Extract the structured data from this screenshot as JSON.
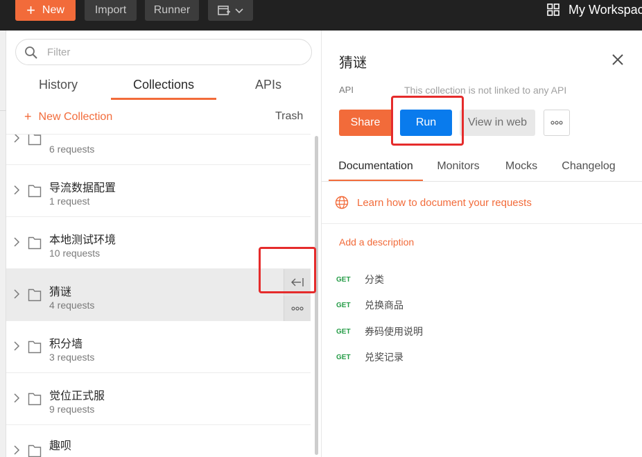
{
  "topbar": {
    "new_label": "New",
    "import_label": "Import",
    "runner_label": "Runner",
    "workspace_label": "My Workspac"
  },
  "sidebar": {
    "filter_placeholder": "Filter",
    "tabs": [
      {
        "label": "History"
      },
      {
        "label": "Collections"
      },
      {
        "label": "APIs"
      }
    ],
    "new_collection_label": "New Collection",
    "trash_label": "Trash",
    "collections": [
      {
        "name": "",
        "count": "6 requests"
      },
      {
        "name": "导流数据配置",
        "count": "1 request"
      },
      {
        "name": "本地测试环境",
        "count": "10 requests"
      },
      {
        "name": "猜谜",
        "count": "4 requests"
      },
      {
        "name": "积分墙",
        "count": "3 requests"
      },
      {
        "name": "觉位正式服",
        "count": "9 requests"
      },
      {
        "name": "趣呗",
        "count": ""
      }
    ]
  },
  "detail": {
    "title": "猜谜",
    "api_label": "API",
    "api_note": "This collection is not linked to any API",
    "share_label": "Share",
    "run_label": "Run",
    "view_web_label": "View in web",
    "tabs": [
      {
        "label": "Documentation"
      },
      {
        "label": "Monitors"
      },
      {
        "label": "Mocks"
      },
      {
        "label": "Changelog"
      }
    ],
    "learn_label": "Learn how to document your requests",
    "add_description_label": "Add a description",
    "requests": [
      {
        "method": "GET",
        "name": "分类"
      },
      {
        "method": "GET",
        "name": "兑换商品"
      },
      {
        "method": "GET",
        "name": "券码使用说明"
      },
      {
        "method": "GET",
        "name": "兑奖记录"
      }
    ]
  },
  "colors": {
    "accent": "#f26b3a",
    "run_blue": "#097bed",
    "get_green": "#259c47",
    "highlight_red": "#e52b2b"
  }
}
